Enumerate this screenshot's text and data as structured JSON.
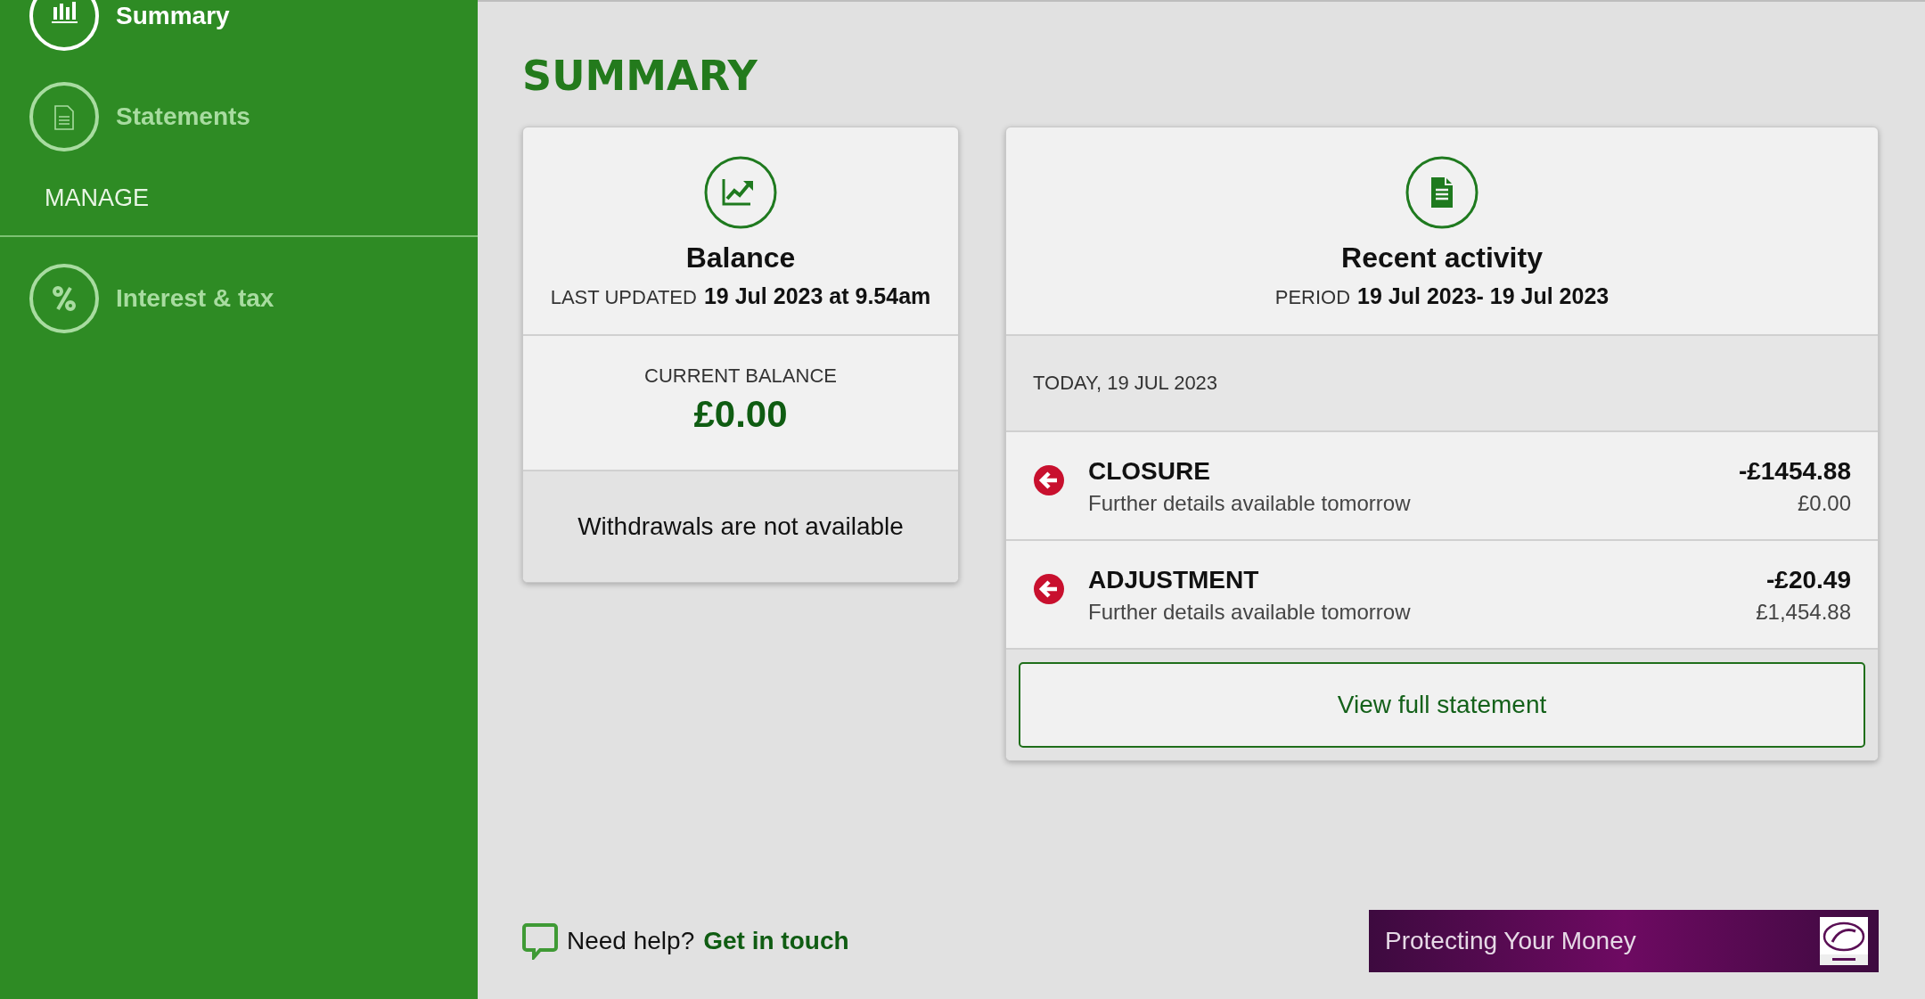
{
  "sidebar": {
    "items": [
      {
        "label": "Summary",
        "kind": "chart",
        "selected": true
      },
      {
        "label": "Statements",
        "kind": "document",
        "selected": false
      }
    ],
    "section": "MANAGE",
    "manage_items": [
      {
        "label": "Interest & tax",
        "kind": "percent",
        "selected": false
      }
    ]
  },
  "page_title": "SUMMARY",
  "balance_card": {
    "title": "Balance",
    "updated_label": "LAST UPDATED",
    "updated_value": "19 Jul 2023 at 9.54am",
    "current_label": "CURRENT BALANCE",
    "current_value": "£0.00",
    "notice": "Withdrawals are not available"
  },
  "activity_card": {
    "title": "Recent activity",
    "period_label": "PERIOD",
    "period_value": "19 Jul 2023- 19 Jul 2023",
    "date_heading": "TODAY, 19 JUL 2023",
    "transactions": [
      {
        "name": "CLOSURE",
        "detail": "Further details available tomorrow",
        "amount": "-£1454.88",
        "balance": "£0.00"
      },
      {
        "name": "ADJUSTMENT",
        "detail": "Further details available tomorrow",
        "amount": "-£20.49",
        "balance": "£1,454.88"
      }
    ],
    "button": "View full statement"
  },
  "help": {
    "text": "Need help?",
    "link": "Get in touch"
  },
  "banner": {
    "text": "Protecting Your Money"
  }
}
